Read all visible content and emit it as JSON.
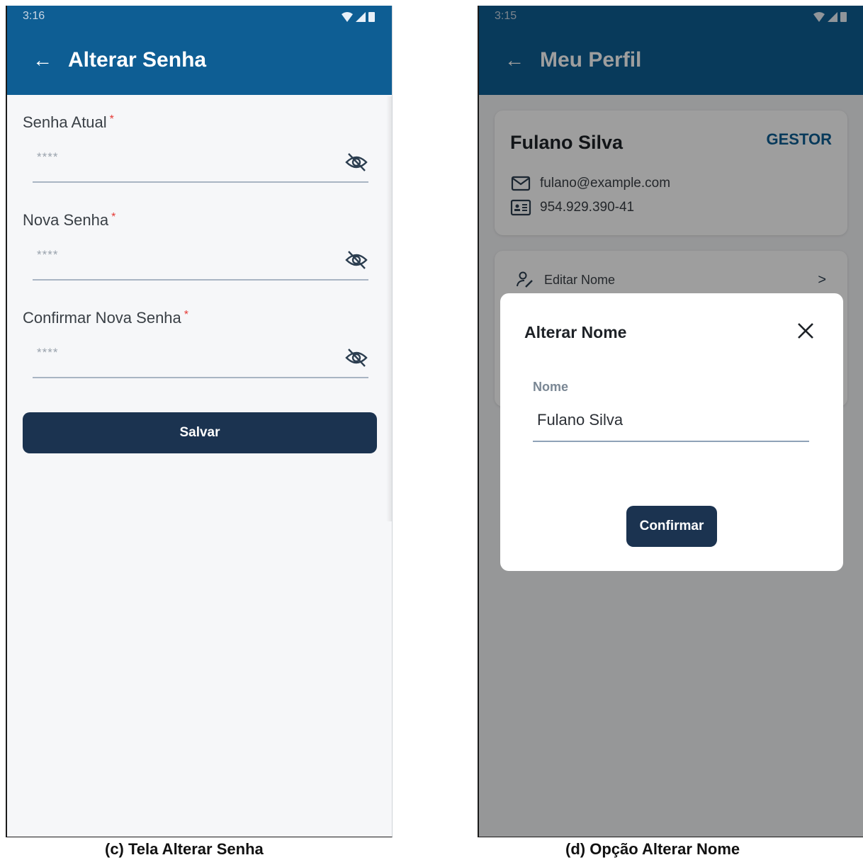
{
  "left_screen": {
    "status_time": "3:16",
    "title": "Alterar Senha",
    "fields": [
      {
        "label": "Senha Atual",
        "required_mark": "*",
        "value": "****"
      },
      {
        "label": "Nova Senha",
        "required_mark": "*",
        "value": "****"
      },
      {
        "label": "Confirmar Nova Senha",
        "required_mark": "*",
        "value": "****"
      }
    ],
    "save_label": "Salvar",
    "caption": "(c) Tela Alterar Senha"
  },
  "right_screen": {
    "status_time": "3:15",
    "title": "Meu Perfil",
    "profile": {
      "name": "Fulano Silva",
      "role": "GESTOR",
      "email": "fulano@example.com",
      "cpf": "954.929.390-41"
    },
    "menu": {
      "edit_name_label": "Editar Nome",
      "chevron": ">"
    },
    "dialog": {
      "title": "Alterar Nome",
      "field_label": "Nome",
      "field_value": "Fulano Silva",
      "confirm_label": "Confirmar"
    },
    "caption": "(d) Opção Alterar Nome"
  },
  "colors": {
    "appbar_left": "#0e5e94",
    "appbar_right_dimmed": "#0a3f63",
    "button": "#1b3350",
    "required": "#e53935",
    "role": "#0e5e94"
  },
  "icons": {
    "back": "arrow-left",
    "password_visibility": "eye-off",
    "email": "mail",
    "document": "id-card",
    "edit_user": "user-edit",
    "close": "x"
  }
}
